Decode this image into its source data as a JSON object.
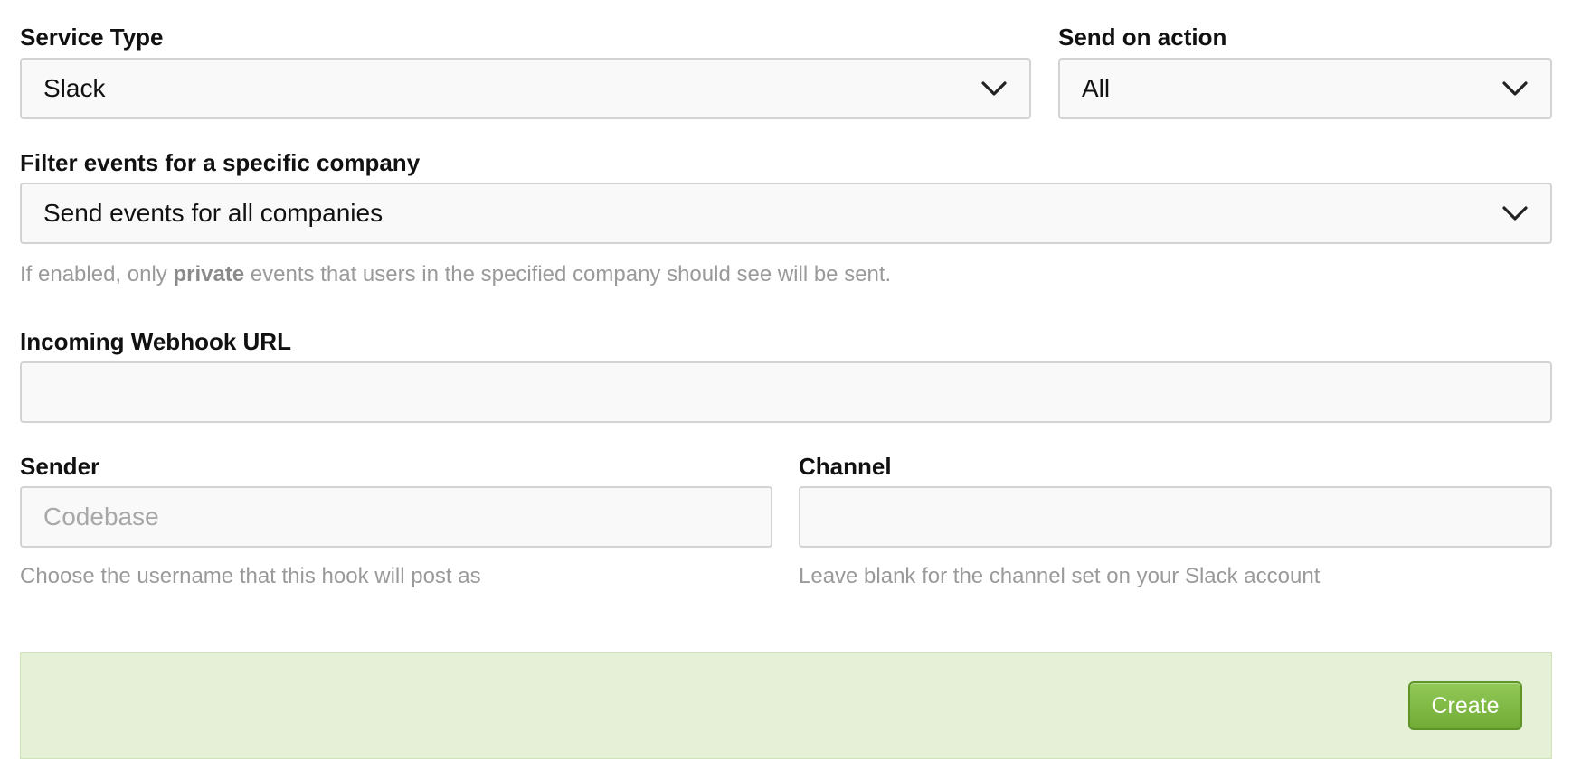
{
  "service_type": {
    "label": "Service Type",
    "selected": "Slack"
  },
  "send_on_action": {
    "label": "Send on action",
    "selected": "All"
  },
  "company_filter": {
    "label": "Filter events for a specific company",
    "selected": "Send events for all companies",
    "help_before": "If enabled, only ",
    "help_bold": "private",
    "help_after": " events that users in the specified company should see will be sent."
  },
  "webhook_url": {
    "label": "Incoming Webhook URL",
    "value": ""
  },
  "sender": {
    "label": "Sender",
    "placeholder": "Codebase",
    "help": "Choose the username that this hook will post as"
  },
  "channel": {
    "label": "Channel",
    "value": "",
    "help": "Leave blank for the channel set on your Slack account"
  },
  "actions": {
    "create_label": "Create"
  },
  "colors": {
    "field_background": "#f9f9f9",
    "field_border": "#d3d3d3",
    "help_text": "#9a9a9a",
    "actions_background": "#e5f0d7",
    "create_button": "#7fb842"
  },
  "icons": {
    "select_arrow": "chevron-down-icon"
  }
}
